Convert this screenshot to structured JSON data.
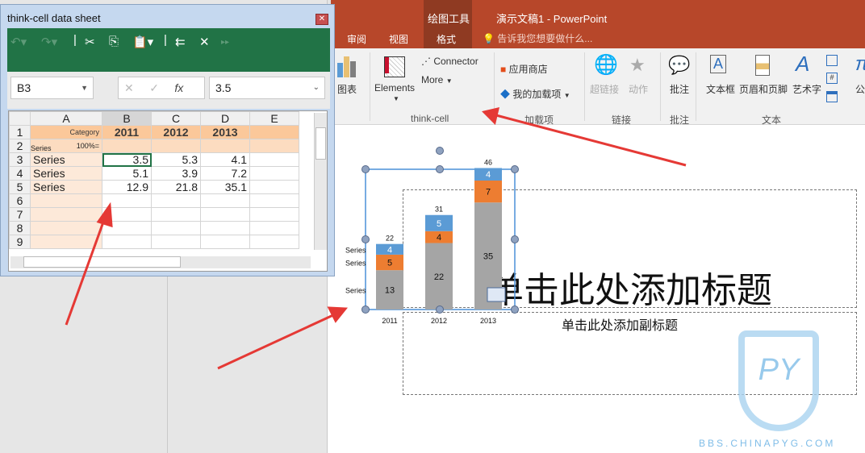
{
  "datasheet": {
    "title": "think-cell data sheet",
    "name_box": "B3",
    "formula_value": "3.5",
    "columns": [
      "A",
      "B",
      "C",
      "D",
      "E"
    ],
    "rows": [
      "1",
      "2",
      "3",
      "4",
      "5",
      "6",
      "7",
      "8",
      "9"
    ],
    "category_label": "Category",
    "percent_label": "100%=",
    "series_label": "Series",
    "categories": [
      "2011",
      "2012",
      "2013"
    ],
    "series_rows": [
      {
        "name": "Series",
        "values": [
          "3.5",
          "5.3",
          "4.1"
        ]
      },
      {
        "name": "Series",
        "values": [
          "5.1",
          "3.9",
          "7.2"
        ]
      },
      {
        "name": "Series",
        "values": [
          "12.9",
          "21.8",
          "35.1"
        ]
      }
    ]
  },
  "powerpoint": {
    "title": "演示文稿1 - PowerPoint",
    "context_tab": "绘图工具",
    "tabs": [
      "审阅",
      "视图",
      "格式"
    ],
    "active_tab": "格式",
    "tell_me": "告诉我您想要做什么...",
    "ribbon": {
      "chart": "图表",
      "elements": "Elements",
      "connector": "Connector",
      "more": "More",
      "store": "应用商店",
      "my_addins": "我的加载项",
      "hyperlink": "超链接",
      "action": "动作",
      "comment": "批注",
      "textbox": "文本框",
      "header_footer": "页眉和页脚",
      "wordart": "艺术字",
      "formula": "公"
    },
    "groups": [
      "think-cell",
      "加载项",
      "链接",
      "批注",
      "文本"
    ],
    "accent": "#b7472a"
  },
  "slide": {
    "title_placeholder": "单击此处添加标题",
    "subtitle_placeholder": "单击此处添加副标题",
    "watermark": "BBS.CHINAPYG.COM"
  },
  "chart_data": {
    "type": "bar",
    "stacked": true,
    "categories": [
      "2011",
      "2012",
      "2013"
    ],
    "series": [
      {
        "name": "Series",
        "values": [
          12.9,
          21.8,
          35.1
        ],
        "color": "#a5a5a5"
      },
      {
        "name": "Series",
        "values": [
          5.1,
          3.9,
          7.2
        ],
        "color": "#ed7d31"
      },
      {
        "name": "Series",
        "values": [
          3.5,
          5.3,
          4.1
        ],
        "color": "#5b9bd5"
      }
    ],
    "totals": [
      22,
      31,
      46
    ]
  }
}
